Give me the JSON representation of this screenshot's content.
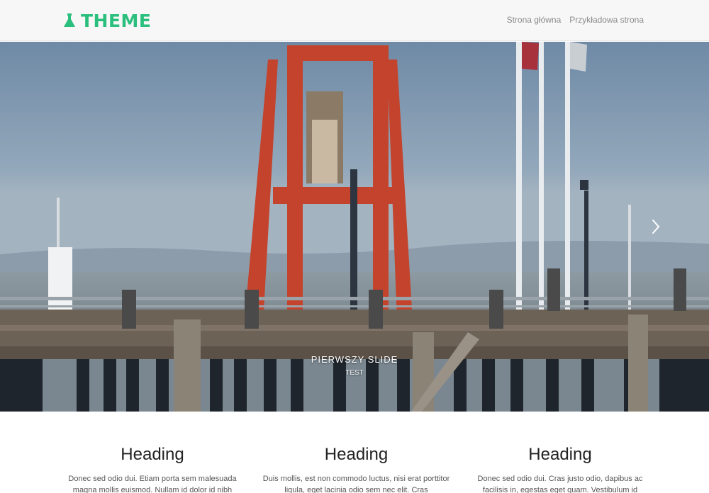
{
  "brand": {
    "name": "THEME",
    "icon": "flask-icon",
    "color": "#2bbf7e"
  },
  "nav": {
    "items": [
      {
        "label": "Strona główna"
      },
      {
        "label": "Przykładowa strona"
      }
    ]
  },
  "carousel": {
    "slide_title": "PIERWSZY SLIDE",
    "slide_subtitle": "TEST",
    "next_icon": "chevron-right-icon",
    "prev_icon": "chevron-left-icon"
  },
  "columns": [
    {
      "heading": "Heading",
      "text": "Donec sed odio dui. Etiam porta sem malesuada magna mollis euismod. Nullam id dolor id nibh"
    },
    {
      "heading": "Heading",
      "text": "Duis mollis, est non commodo luctus, nisi erat porttitor ligula, eget lacinia odio sem nec elit. Cras"
    },
    {
      "heading": "Heading",
      "text": "Donec sed odio dui. Cras justo odio, dapibus ac facilisis in, egestas eget quam. Vestibulum id"
    }
  ]
}
